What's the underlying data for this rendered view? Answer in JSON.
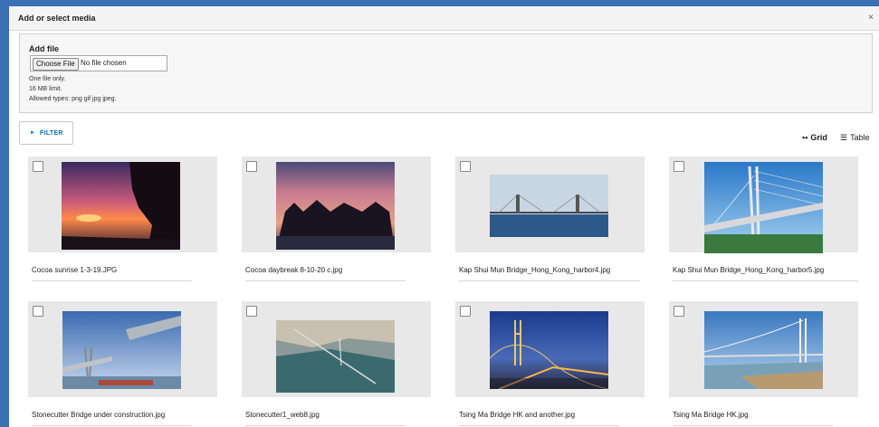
{
  "dialog": {
    "title": "Add or select media",
    "close_icon": "×"
  },
  "add_file": {
    "label": "Add file",
    "button_label": "Choose File",
    "no_file_text": "No file chosen",
    "help": [
      "One file only.",
      "16 MB limit.",
      "Allowed types: png gif jpg jpeg."
    ]
  },
  "filter": {
    "arrow": "►",
    "label": "FILTER"
  },
  "views": {
    "grid_label": "Grid",
    "table_label": "Table"
  },
  "media": [
    {
      "caption": "Cocoa sunrise 1-3-19.JPG",
      "image": "sunset"
    },
    {
      "caption": "Cocoa daybreak 8-10-20 c.jpg",
      "image": "daybreak"
    },
    {
      "caption": "Kap Shui Mun Bridge_Hong_Kong_harbor4.jpg",
      "image": "bridge-harbor"
    },
    {
      "caption": "Kap Shui Mun Bridge_Hong_Kong_harbor5.jpg",
      "image": "bridge-tower"
    },
    {
      "caption": "Stonecutter Bridge under construction.jpg",
      "image": "construction"
    },
    {
      "caption": "Stonecutter1_web8.jpg",
      "image": "aerial"
    },
    {
      "caption": "Tsing Ma Bridge HK and another.jpg",
      "image": "night-bridge"
    },
    {
      "caption": "Tsing Ma Bridge HK.jpg",
      "image": "suspension-bridge"
    }
  ]
}
